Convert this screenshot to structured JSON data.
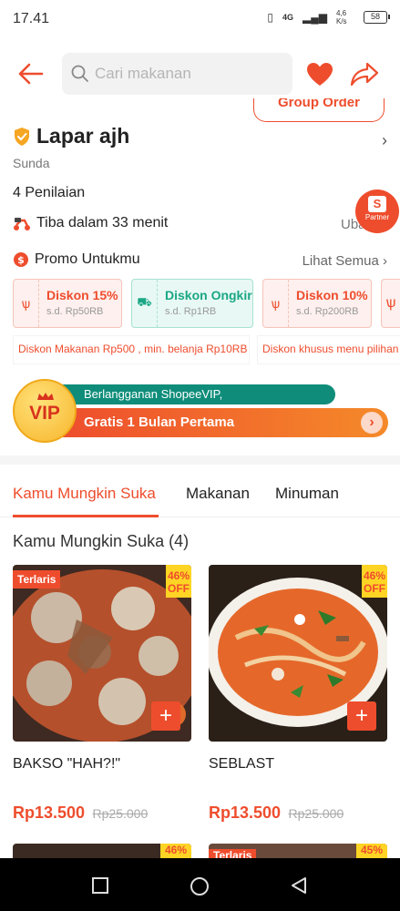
{
  "status_bar": {
    "time": "17.41",
    "network": "4G",
    "speed": "4,6 K/s",
    "battery": "58"
  },
  "search": {
    "placeholder": "Cari makanan"
  },
  "group_order": {
    "label": "Group Order"
  },
  "store": {
    "name": "Lapar ajh",
    "cuisine": "Sunda",
    "ratings": "4 Penilaian",
    "eta": "Tiba dalam 33 menit",
    "eta_action": "Ubah",
    "partner_label": "Partner"
  },
  "promo": {
    "heading": "Promo Untukmu",
    "see_all": "Lihat Semua",
    "vouchers": [
      {
        "title": "Diskon 15%",
        "sub": "s.d. Rp50RB",
        "style": "food"
      },
      {
        "title": "Diskon Ongkir",
        "sub": "s.d. Rp1RB",
        "style": "shipping"
      },
      {
        "title": "Diskon 10%",
        "sub": "s.d. Rp200RB",
        "style": "food"
      }
    ],
    "descriptions": [
      "Diskon Makanan Rp500 , min. belanja Rp10RB",
      "Diskon khusus menu pilihan"
    ]
  },
  "vip": {
    "badge": "VIP",
    "line1": "Berlangganan ShopeeVIP,",
    "line2": "Gratis 1 Bulan Pertama"
  },
  "tabs": [
    "Kamu Mungkin Suka",
    "Makanan",
    "Minuman"
  ],
  "section": {
    "title": "Kamu Mungkin Suka (4)"
  },
  "products": [
    {
      "name": "BAKSO \"HAH?!\"",
      "price": "Rp13.500",
      "original_price": "Rp25.000",
      "discount_pct": "46%",
      "discount_label": "OFF",
      "tag": "Terlaris"
    },
    {
      "name": "SEBLAST",
      "price": "Rp13.500",
      "original_price": "Rp25.000",
      "discount_pct": "46%",
      "discount_label": "OFF",
      "tag": ""
    }
  ],
  "peek_items": [
    {
      "discount_pct": "46%",
      "tag": ""
    },
    {
      "discount_pct": "45%",
      "tag": "Terlaris"
    }
  ],
  "colors": {
    "accent": "#ee4d2d",
    "green": "#1aa784",
    "vip_teal": "#0f8d7a",
    "vip_gold": "#f7b52b"
  }
}
